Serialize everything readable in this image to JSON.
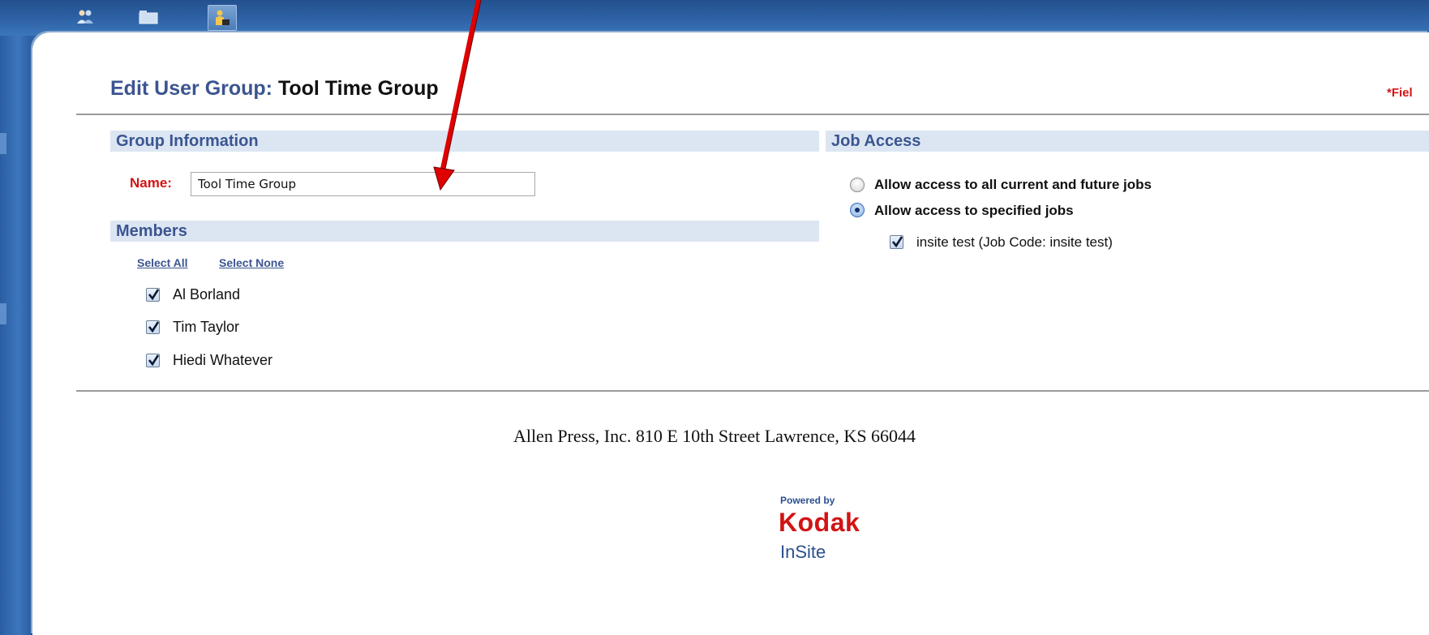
{
  "toolbar": {
    "tools": [
      {
        "icon": "users-icon"
      },
      {
        "icon": "folder-icon"
      },
      {
        "icon": "user-groups-icon",
        "active": true
      }
    ]
  },
  "page": {
    "title_label": "Edit User Group:",
    "title_value": "Tool Time Group",
    "required_note": "*Fiel"
  },
  "group_info": {
    "heading": "Group Information",
    "name_label": "Name:",
    "name_value": "Tool Time Group"
  },
  "members": {
    "heading": "Members",
    "select_all": "Select All",
    "select_none": "Select None",
    "list": [
      {
        "name": "Al Borland",
        "checked": true
      },
      {
        "name": "Tim Taylor",
        "checked": true
      },
      {
        "name": "Hiedi Whatever",
        "checked": true
      }
    ]
  },
  "job_access": {
    "heading": "Job Access",
    "options": [
      {
        "label": "Allow access to all current and future jobs",
        "selected": false
      },
      {
        "label": "Allow access to specified jobs",
        "selected": true
      }
    ],
    "jobs": [
      {
        "label": "insite test (Job Code: insite test)",
        "checked": true
      }
    ]
  },
  "footer": {
    "address": "Allen Press, Inc. 810 E 10th Street Lawrence, KS 66044",
    "powered_by": "Powered by",
    "brand": "Kodak",
    "product": "InSite"
  },
  "colors": {
    "label_blue": "#3b5590",
    "required_red": "#d21414",
    "section_bg": "#dce6f3",
    "annotation_arrow": "#e00000"
  }
}
